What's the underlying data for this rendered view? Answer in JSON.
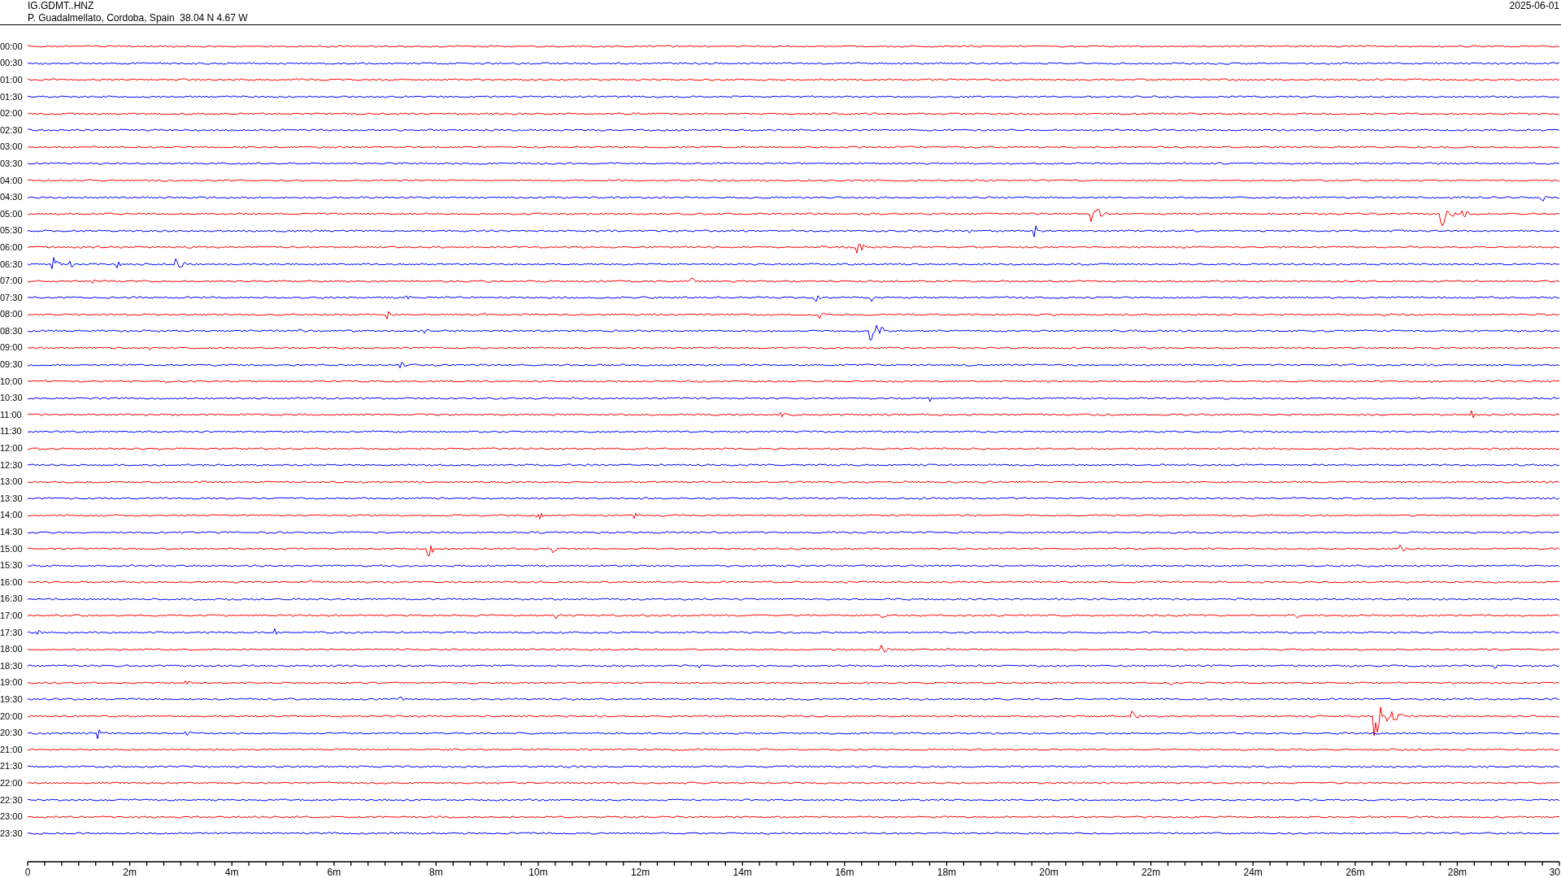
{
  "header": {
    "station": "IG.GDMT..HNZ",
    "location": "P. Guadalmellato, Cordoba, Spain  38.04 N 4.67 W",
    "date": "2025-06-01"
  },
  "rows": [
    {
      "time": "00:00",
      "color": "#ff0000"
    },
    {
      "time": "00:30",
      "color": "#0000ff"
    },
    {
      "time": "01:00",
      "color": "#ff0000"
    },
    {
      "time": "01:30",
      "color": "#0000ff"
    },
    {
      "time": "02:00",
      "color": "#ff0000"
    },
    {
      "time": "02:30",
      "color": "#0000ff"
    },
    {
      "time": "03:00",
      "color": "#ff0000"
    },
    {
      "time": "03:30",
      "color": "#0000ff"
    },
    {
      "time": "04:00",
      "color": "#ff0000"
    },
    {
      "time": "04:30",
      "color": "#0000ff"
    },
    {
      "time": "05:00",
      "color": "#ff0000"
    },
    {
      "time": "05:30",
      "color": "#0000ff"
    },
    {
      "time": "06:00",
      "color": "#ff0000"
    },
    {
      "time": "06:30",
      "color": "#0000ff"
    },
    {
      "time": "07:00",
      "color": "#ff0000"
    },
    {
      "time": "07:30",
      "color": "#0000ff"
    },
    {
      "time": "08:00",
      "color": "#ff0000"
    },
    {
      "time": "08:30",
      "color": "#0000ff"
    },
    {
      "time": "09:00",
      "color": "#ff0000"
    },
    {
      "time": "09:30",
      "color": "#0000ff"
    },
    {
      "time": "10:00",
      "color": "#ff0000"
    },
    {
      "time": "10:30",
      "color": "#0000ff"
    },
    {
      "time": "11:00",
      "color": "#ff0000"
    },
    {
      "time": "11:30",
      "color": "#0000ff"
    },
    {
      "time": "12:00",
      "color": "#ff0000"
    },
    {
      "time": "12:30",
      "color": "#0000ff"
    },
    {
      "time": "13:00",
      "color": "#ff0000"
    },
    {
      "time": "13:30",
      "color": "#0000ff"
    },
    {
      "time": "14:00",
      "color": "#ff0000"
    },
    {
      "time": "14:30",
      "color": "#0000ff"
    },
    {
      "time": "15:00",
      "color": "#ff0000"
    },
    {
      "time": "15:30",
      "color": "#0000ff"
    },
    {
      "time": "16:00",
      "color": "#ff0000"
    },
    {
      "time": "16:30",
      "color": "#0000ff"
    },
    {
      "time": "17:00",
      "color": "#ff0000"
    },
    {
      "time": "17:30",
      "color": "#0000ff"
    },
    {
      "time": "18:00",
      "color": "#ff0000"
    },
    {
      "time": "18:30",
      "color": "#0000ff"
    },
    {
      "time": "19:00",
      "color": "#ff0000"
    },
    {
      "time": "19:30",
      "color": "#0000ff"
    },
    {
      "time": "20:00",
      "color": "#ff0000"
    },
    {
      "time": "20:30",
      "color": "#0000ff"
    },
    {
      "time": "21:00",
      "color": "#ff0000"
    },
    {
      "time": "21:30",
      "color": "#0000ff"
    },
    {
      "time": "22:00",
      "color": "#ff0000"
    },
    {
      "time": "22:30",
      "color": "#0000ff"
    },
    {
      "time": "23:00",
      "color": "#ff0000"
    },
    {
      "time": "23:30",
      "color": "#0000ff"
    }
  ],
  "x_axis": {
    "labels": [
      "0",
      "2m",
      "4m",
      "6m",
      "8m",
      "10m",
      "12m",
      "14m",
      "16m",
      "18m",
      "20m",
      "22m",
      "24m",
      "26m",
      "28m",
      "30"
    ]
  }
}
